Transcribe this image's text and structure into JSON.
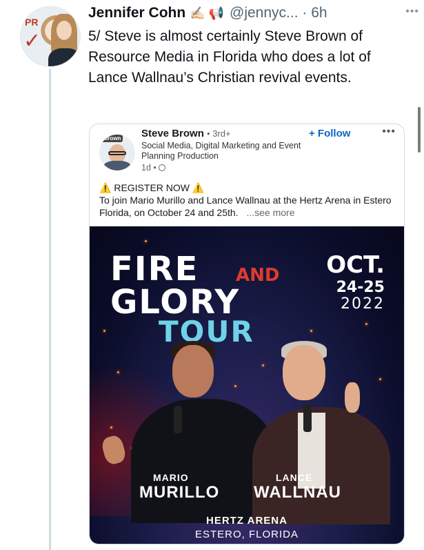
{
  "tweet": {
    "author_name": "Jennifer Cohn",
    "author_emojis": "✍🏻 📢",
    "handle_time": "@jennyc... · 6h",
    "more_icon": "more-dots-icon",
    "text": "5/ Steve is almost certainly Steve Brown of Resource Media in Florida who does a lot of Lance Wallnau’s Christian revival events."
  },
  "embedded_post": {
    "avatar_badge": "ebrown",
    "name": "Steve Brown",
    "degree": "• 3rd+",
    "follow_label": "+ Follow",
    "headline": "Social Media, Digital Marketing and Event Planning Production",
    "time": "1d •",
    "line1": "REGISTER NOW",
    "line2": "To join Mario Murillo and Lance Wallnau at the Hertz Arena in Estero Florida, on October 24 and 25th.",
    "see_more": "...see more"
  },
  "poster": {
    "fire": "FIRE",
    "and": "AND",
    "glory": "GLORY",
    "tour": "TOUR",
    "month": "OCT.",
    "days": "24-25",
    "year": "2022",
    "speaker1_first": "MARIO",
    "speaker1_last": "MURILLO",
    "speaker2_first": "LANCE",
    "speaker2_last": "WALLNAU",
    "venue": "HERTZ ARENA",
    "city": "ESTERO, FLORIDA"
  },
  "colors": {
    "linkedin_blue": "#0a66c2",
    "tour_cyan": "#6fd3e8",
    "and_red": "#e03a2e"
  }
}
